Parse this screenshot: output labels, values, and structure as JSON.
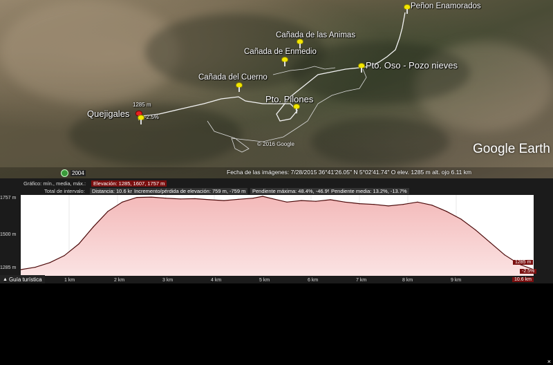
{
  "map": {
    "places": [
      {
        "id": "penon",
        "label": "Peñon Enamorados"
      },
      {
        "id": "animas",
        "label": "Cañada de las Animas"
      },
      {
        "id": "enmedio",
        "label": "Cañada de Enmedio"
      },
      {
        "id": "oso",
        "label": "Pto. Oso - Pozo nieves"
      },
      {
        "id": "cuerno",
        "label": "Cañada del Cuerno"
      },
      {
        "id": "pilones",
        "label": "Pto. Pilones"
      },
      {
        "id": "quejigales",
        "label": "Quejigales"
      }
    ],
    "cursor_elev": "1285 m",
    "cursor_pct": "-2.5%",
    "copyright": "© 2016 Google",
    "logo": "Google Earth",
    "status": "Fecha de las imágenes: 7/28/2015    36°41'26.05\" N    5°02'41.74\" O  elev.  1285 m    alt. ojo   6.11 km",
    "history_year": "2004"
  },
  "profile": {
    "grafico_label": "Gráfico: mín., media, máx.:",
    "elevation_value": "Elevación: 1285, 1607, 1757 m",
    "interval_label": "Total de intervalo:",
    "distance": "Distancia: 10.6 km",
    "gain_loss": "Incremento/pérdida de elevación: 759 m, -759 m",
    "max_slope": "Pendiente máxima: 48.4%, -46.9%",
    "avg_slope": "Pendiente media: 13.2%, -13.7%",
    "y_ticks": [
      "1757 m",
      "1500 m",
      "1285 m"
    ],
    "x_ticks": [
      "1 km",
      "2 km",
      "3 km",
      "4 km",
      "5 km",
      "6 km",
      "7 km",
      "8 km",
      "9 km"
    ],
    "end_value": "1285 m",
    "end_pct": "-2.5%",
    "end_x": "10.6 km",
    "guide": "Guía turística",
    "close": "×"
  },
  "chart_data": {
    "type": "area",
    "xlabel": "",
    "ylabel": "",
    "ylim": [
      1285,
      1757
    ],
    "xlim": [
      0,
      10.6
    ],
    "x": [
      0,
      0.3,
      0.6,
      0.9,
      1.2,
      1.5,
      1.8,
      2.1,
      2.4,
      2.7,
      3.0,
      3.3,
      3.6,
      3.9,
      4.2,
      4.5,
      4.8,
      5.0,
      5.2,
      5.5,
      5.8,
      6.1,
      6.4,
      6.7,
      7.0,
      7.3,
      7.6,
      7.9,
      8.2,
      8.5,
      8.8,
      9.1,
      9.4,
      9.7,
      10.0,
      10.3,
      10.6
    ],
    "y": [
      1285,
      1300,
      1330,
      1375,
      1450,
      1560,
      1660,
      1720,
      1750,
      1752,
      1745,
      1740,
      1742,
      1735,
      1730,
      1738,
      1745,
      1757,
      1742,
      1720,
      1730,
      1725,
      1735,
      1720,
      1710,
      1705,
      1695,
      1705,
      1720,
      1700,
      1660,
      1610,
      1540,
      1460,
      1380,
      1320,
      1285
    ]
  }
}
